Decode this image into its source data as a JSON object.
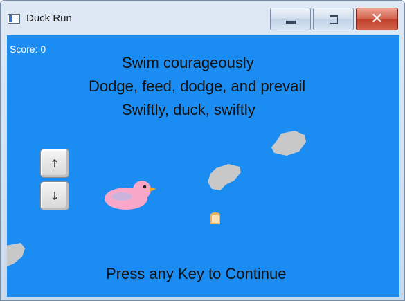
{
  "window": {
    "title": "Duck Run",
    "controls": {
      "minimize": "minimize",
      "maximize": "maximize",
      "close": "✕"
    }
  },
  "game": {
    "score_text": "Score: 0",
    "tagline": [
      "Swim courageously",
      "Dodge, feed, dodge, and prevail",
      "Swiftly, duck, swiftly"
    ],
    "continue_prompt": "Press any Key to Continue",
    "keys": {
      "up": "↑",
      "down": "↓"
    },
    "colors": {
      "water": "#1a8cf2",
      "duck": "#f9a8c9",
      "rock": "#c8c8c8",
      "bread": "#e8b060"
    }
  }
}
